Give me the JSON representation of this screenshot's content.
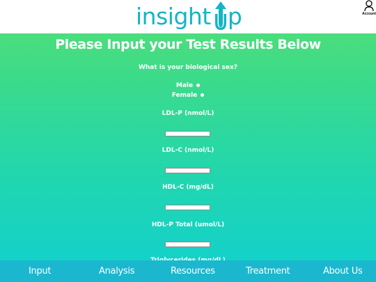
{
  "header": {
    "logo": {
      "part1": "insight",
      "part2_U": "U",
      "part2_p": "p"
    },
    "account_label": "Account"
  },
  "main": {
    "title": "Please Input your Test Results Below",
    "sex_question": "What is your biological sex?",
    "sex_options": [
      "Male",
      "Female"
    ],
    "fields": [
      {
        "label": "LDL-P (nmol/L)",
        "value": ""
      },
      {
        "label": "LDL-C (nmol/L)",
        "value": ""
      },
      {
        "label": "HDL-C (mg/dL)",
        "value": ""
      },
      {
        "label": "HDL-P Total (umol/L)",
        "value": ""
      },
      {
        "label": "Triglycerides (mg/dL)"
      }
    ]
  },
  "nav": {
    "items": [
      "Input",
      "Analysis",
      "Resources",
      "Treatment",
      "About Us"
    ]
  },
  "colors": {
    "gradient_top": "#57df72",
    "gradient_bottom": "#11d0cf",
    "logo": "#14b5c5",
    "navbar": "#1bb7cf"
  }
}
